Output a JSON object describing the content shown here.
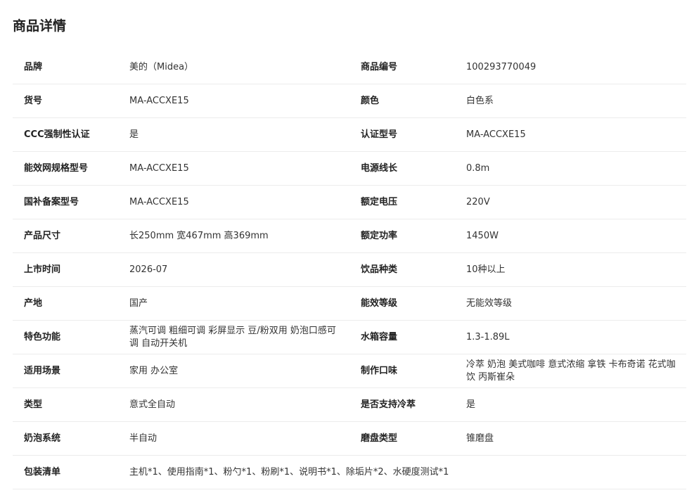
{
  "title": "商品详情",
  "rows": [
    {
      "l1": "品牌",
      "v1": "美的（Midea）",
      "l2": "商品编号",
      "v2": "100293770049"
    },
    {
      "l1": "货号",
      "v1": "MA-ACCXE15",
      "l2": "颜色",
      "v2": "白色系"
    },
    {
      "l1": "CCC强制性认证",
      "v1": "是",
      "l2": "认证型号",
      "v2": "MA-ACCXE15"
    },
    {
      "l1": "能效网规格型号",
      "v1": "MA-ACCXE15",
      "l2": "电源线长",
      "v2": "0.8m"
    },
    {
      "l1": "国补备案型号",
      "v1": "MA-ACCXE15",
      "l2": "额定电压",
      "v2": "220V"
    },
    {
      "l1": "产品尺寸",
      "v1": "长250mm 宽467mm 高369mm",
      "l2": "额定功率",
      "v2": "1450W"
    },
    {
      "l1": "上市时间",
      "v1": "2026-07",
      "l2": "饮品种类",
      "v2": "10种以上"
    },
    {
      "l1": "产地",
      "v1": "国产",
      "l2": "能效等级",
      "v2": "无能效等级"
    },
    {
      "l1": "特色功能",
      "v1": "蒸汽可调 粗细可调 彩屏显示 豆/粉双用 奶泡口感可调 自动开关机",
      "l2": "水箱容量",
      "v2": "1.3-1.89L"
    },
    {
      "l1": "适用场景",
      "v1": "家用 办公室",
      "l2": "制作口味",
      "v2": "冷萃 奶泡 美式咖啡 意式浓缩 拿铁 卡布奇诺 花式咖饮 丙斯崔朵"
    },
    {
      "l1": "类型",
      "v1": "意式全自动",
      "l2": "是否支持冷萃",
      "v2": "是"
    },
    {
      "l1": "奶泡系统",
      "v1": "半自动",
      "l2": "磨盘类型",
      "v2": "锥磨盘"
    }
  ],
  "package": {
    "label": "包装清单",
    "value": "主机*1、使用指南*1、粉勺*1、粉刷*1、说明书*1、除垢片*2、水硬度测试*1"
  }
}
